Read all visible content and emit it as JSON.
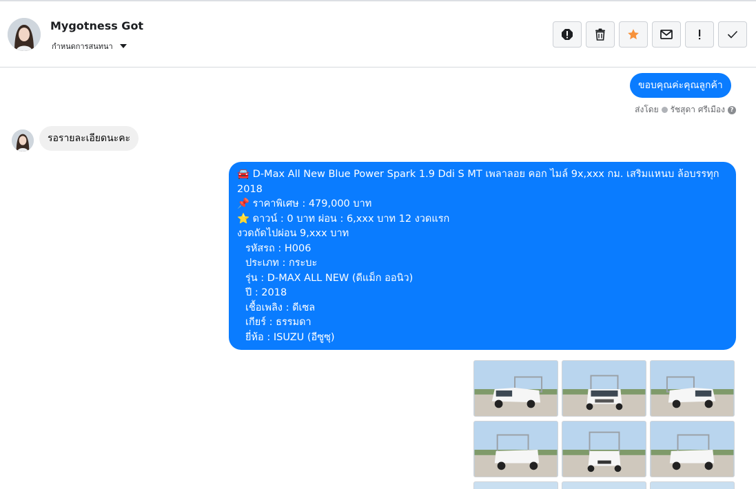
{
  "header": {
    "contact_name": "Mygotness Got",
    "assign_label": "กำหนดการสนทนา",
    "actions": [
      {
        "name": "spam-button",
        "icon": "exclamation-circle-icon"
      },
      {
        "name": "delete-button",
        "icon": "trash-icon"
      },
      {
        "name": "star-button",
        "icon": "star-icon",
        "color": "#f7923b"
      },
      {
        "name": "mark-unread-button",
        "icon": "envelope-icon"
      },
      {
        "name": "follow-up-button",
        "icon": "exclamation-icon"
      },
      {
        "name": "mark-done-button",
        "icon": "check-icon"
      }
    ]
  },
  "messages": {
    "outgoing_thanks": "ขอบคุณค่ะคุณลูกค้า",
    "sent_by_label": "ส่งโดย",
    "sent_by_name": "รัชสุดา ศรีเมือง",
    "help_symbol": "?",
    "incoming_text": "รอรายละเอียดนะคะ",
    "listing": {
      "title": "🚘 D-Max All New Blue Power Spark 1.9 Ddi S MT เพลาลอย คอก ไมล์ 9x,xxx กม. เสริมแหนบ ล้อบรรทุก 2018",
      "price": "📌 ราคาพิเศษ : 479,000 บาท",
      "down": "⭐ ดาวน์ : 0 บาท ผ่อน : 6,xxx บาท 12 งวดแรก",
      "next": "งวดถัดไปผ่อน  9,xxx บาท",
      "code": "รหัสรถ : H006",
      "type": "ประเภท : กระบะ",
      "model": "รุ่น : D-MAX ALL NEW (ดีแม็ก ออนิว)",
      "year": "ปี : 2018",
      "fuel": "เชื้อเพลิง : ดีเซล",
      "gear": "เกียร์ : ธรรมดา",
      "brand": "ยี่ห้อ : ISUZU (อีซูซุ)"
    }
  },
  "photos": [
    {
      "view": "front-left"
    },
    {
      "view": "front"
    },
    {
      "view": "front-right"
    },
    {
      "view": "rear-left"
    },
    {
      "view": "rear"
    },
    {
      "view": "rear-right"
    }
  ],
  "colors": {
    "accent_blue": "#0a7cff",
    "incoming_bubble": "#f0f0f0",
    "star": "#f7923b"
  }
}
